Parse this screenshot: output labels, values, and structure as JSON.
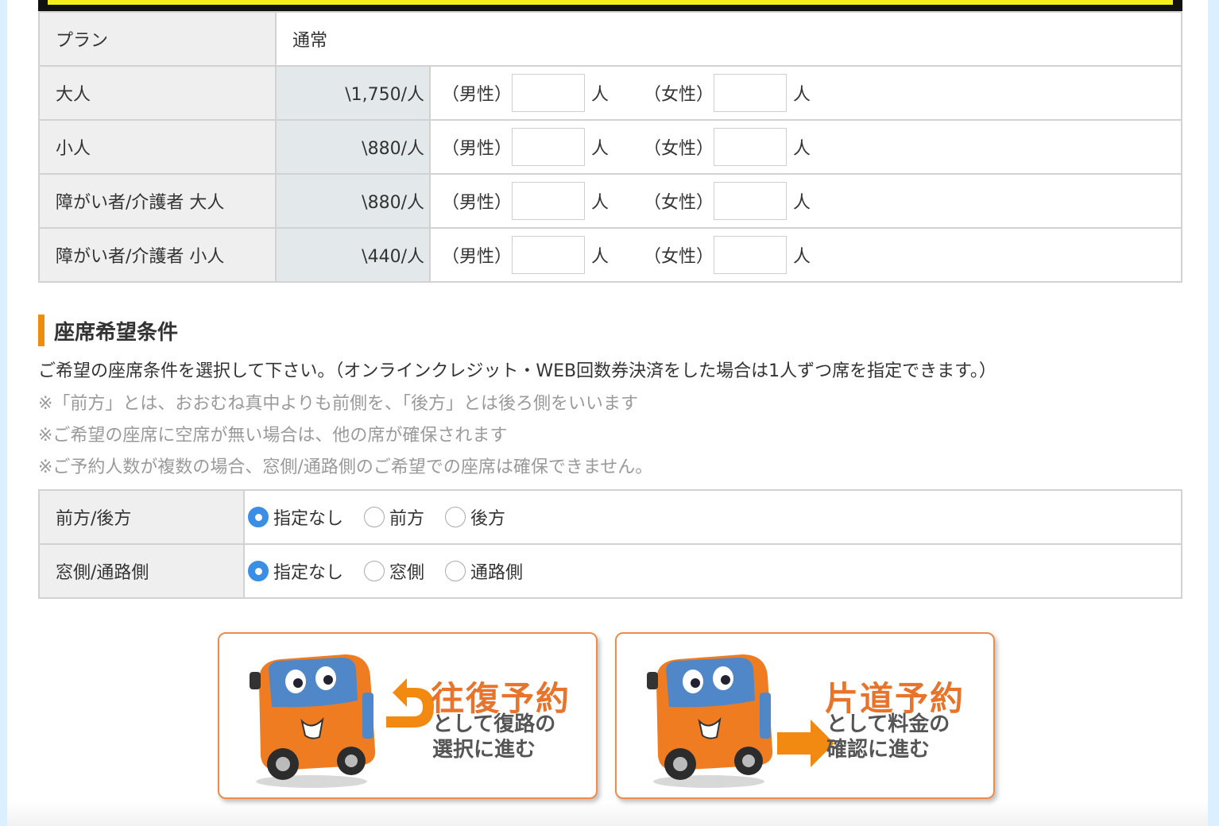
{
  "plan": {
    "label": "プラン",
    "value": "通常"
  },
  "fare_rows": [
    {
      "label": "大人",
      "price": "\\1,750/人",
      "male": "（男性）",
      "female": "（女性）",
      "unit": "人",
      "male_count": "",
      "female_count": ""
    },
    {
      "label": "小人",
      "price": "\\880/人",
      "male": "（男性）",
      "female": "（女性）",
      "unit": "人",
      "male_count": "",
      "female_count": ""
    },
    {
      "label": "障がい者/介護者 大人",
      "price": "\\880/人",
      "male": "（男性）",
      "female": "（女性）",
      "unit": "人",
      "male_count": "",
      "female_count": ""
    },
    {
      "label": "障がい者/介護者 小人",
      "price": "\\440/人",
      "male": "（男性）",
      "female": "（女性）",
      "unit": "人",
      "male_count": "",
      "female_count": ""
    }
  ],
  "seat_section": {
    "title": "座席希望条件",
    "description": "ご希望の座席条件を選択して下さい。（オンラインクレジット・WEB回数券決済をした場合は1人ずつ席を指定できます。）",
    "notes": [
      "※「前方」とは、おおむね真中よりも前側を、「後方」とは後ろ側をいいます",
      "※ご希望の座席に空席が無い場合は、他の席が確保されます",
      "※ご予約人数が複数の場合、窓側/通路側のご希望での座席は確保できません。"
    ],
    "rows": [
      {
        "label": "前方/後方",
        "options": [
          "指定なし",
          "前方",
          "後方"
        ],
        "selected": "指定なし"
      },
      {
        "label": "窓側/通路側",
        "options": [
          "指定なし",
          "窓側",
          "通路側"
        ],
        "selected": "指定なし"
      }
    ]
  },
  "buttons": {
    "round_trip": {
      "title": "往復予約",
      "sub1": "として復路の",
      "sub2": "選択に進む"
    },
    "one_way": {
      "title": "片道予約",
      "sub1": "として料金の",
      "sub2": "確認に進む"
    }
  },
  "colors": {
    "accent_orange": "#f08c0a",
    "button_orange": "#e8732b",
    "radio_blue": "#3a8ee6"
  }
}
